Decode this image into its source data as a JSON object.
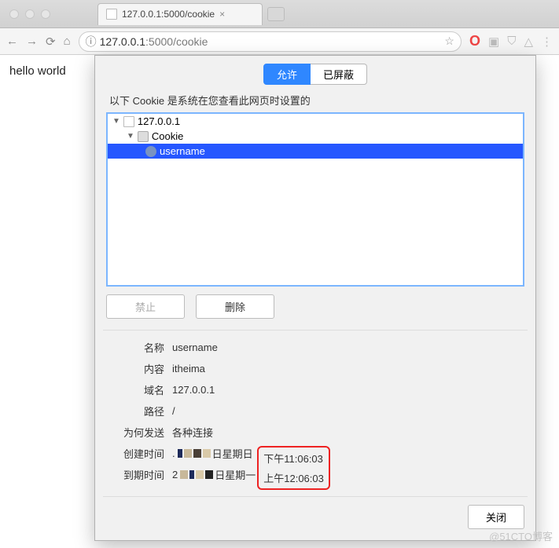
{
  "browser": {
    "tab_title": "127.0.0.1:5000/cookie",
    "url_host": "127.0.0.1",
    "url_rest": ":5000/cookie"
  },
  "page": {
    "body_text": "hello world"
  },
  "dialog": {
    "tabs": {
      "allowed": "允许",
      "blocked": "已屏蔽"
    },
    "caption": "以下 Cookie 是系统在您查看此网页时设置的",
    "tree": {
      "host": "127.0.0.1",
      "group": "Cookie",
      "item": "username"
    },
    "buttons": {
      "block": "禁止",
      "remove": "删除",
      "close": "关闭"
    },
    "details": {
      "labels": {
        "name": "名称",
        "content": "内容",
        "domain": "域名",
        "path": "路径",
        "send_for": "为何发送",
        "created": "创建时间",
        "expires": "到期时间"
      },
      "name": "username",
      "content": "itheima",
      "domain": "127.0.0.1",
      "path": "/",
      "send_for": "各种连接",
      "created_day": "日星期日",
      "created_time": "下午11:06:03",
      "expires_day": "日星期一",
      "expires_time": "上午12:06:03"
    }
  },
  "watermark": "@51CTO博客"
}
